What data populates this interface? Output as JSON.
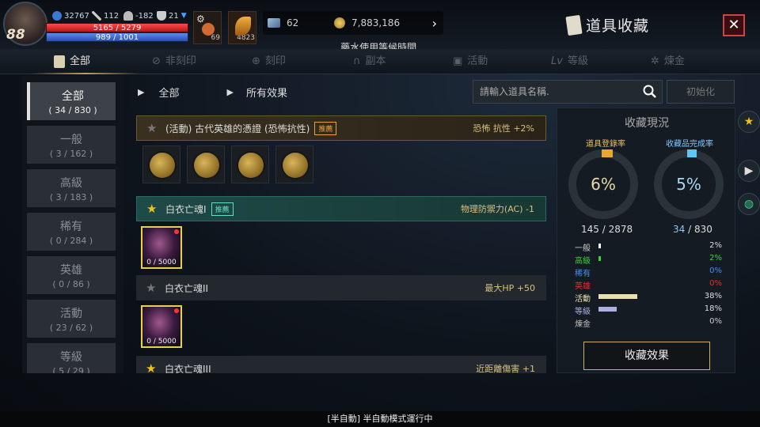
{
  "player": {
    "level": "88",
    "power": "32767",
    "stat1": "112",
    "stat2": "-182",
    "stat3": "21",
    "hp": "5165 / 5279",
    "mp": "989 / 1001"
  },
  "slots": [
    {
      "count": "69",
      "icon": "potion-icon"
    },
    {
      "count": "4823",
      "icon": "feather-icon"
    }
  ],
  "currency": {
    "crystal": "62",
    "gold": "7,883,186"
  },
  "hint": "藥水使用等候時間.",
  "title": "道具收藏",
  "tabs": [
    {
      "label": "全部"
    },
    {
      "label": "非刻印"
    },
    {
      "label": "刻印"
    },
    {
      "label": "副本"
    },
    {
      "label": "活動"
    },
    {
      "label": "等級"
    },
    {
      "label": "煉金"
    }
  ],
  "categories": [
    {
      "name": "全部",
      "count": "( 34 / 830 )"
    },
    {
      "name": "一般",
      "count": "( 3 / 162 )"
    },
    {
      "name": "高級",
      "count": "( 3 / 183 )"
    },
    {
      "name": "稀有",
      "count": "( 0 / 284 )"
    },
    {
      "name": "英雄",
      "count": "( 0 / 86 )"
    },
    {
      "name": "活動",
      "count": "( 23 / 62 )"
    },
    {
      "name": "等級",
      "count": "( 5 / 29 )"
    }
  ],
  "breadcrumb": {
    "first": "全部",
    "second": "所有效果"
  },
  "search": {
    "placeholder": "請輸入道具名稱.",
    "reset": "初始化"
  },
  "rows": [
    {
      "name": "(活動) 古代英雄的憑證 (恐怖抗性)",
      "badge": "推薦",
      "effect": "恐怖 抗性 +2%"
    },
    {
      "name": "白衣亡魂I",
      "badge": "推薦",
      "effect": "物理防禦力(AC) -1",
      "item_count": "0 / 5000"
    },
    {
      "name": "白衣亡魂II",
      "effect": "最大HP +50",
      "item_count": "0 / 5000"
    },
    {
      "name": "白衣亡魂III",
      "effect": "近距離傷害 +1"
    }
  ],
  "collection": {
    "title": "收藏現況",
    "reg_label": "道具登錄率",
    "comp_label": "收藏品完成率",
    "reg_pct": "6%",
    "comp_pct": "5%",
    "reg_count": "145",
    "reg_total": "2878",
    "comp_count": "34",
    "comp_total": "830",
    "breakdown": [
      {
        "name": "一般",
        "pct": "2%",
        "value": 2,
        "color": "#ffffff"
      },
      {
        "name": "高級",
        "pct": "2%",
        "value": 2,
        "color": "#3ad03a"
      },
      {
        "name": "稀有",
        "pct": "0%",
        "value": 0,
        "color": "#4a8cff"
      },
      {
        "name": "英雄",
        "pct": "0%",
        "value": 0,
        "color": "#e03030"
      },
      {
        "name": "活動",
        "pct": "38%",
        "value": 38,
        "color": "#e8e0b0"
      },
      {
        "name": "等級",
        "pct": "18%",
        "value": 18,
        "color": "#b0b0e0"
      },
      {
        "name": "煉金",
        "pct": "0%",
        "value": 0,
        "color": "#c0c0c0"
      }
    ],
    "button": "收藏效果"
  },
  "status": "[半自動] 半自動模式運行中"
}
